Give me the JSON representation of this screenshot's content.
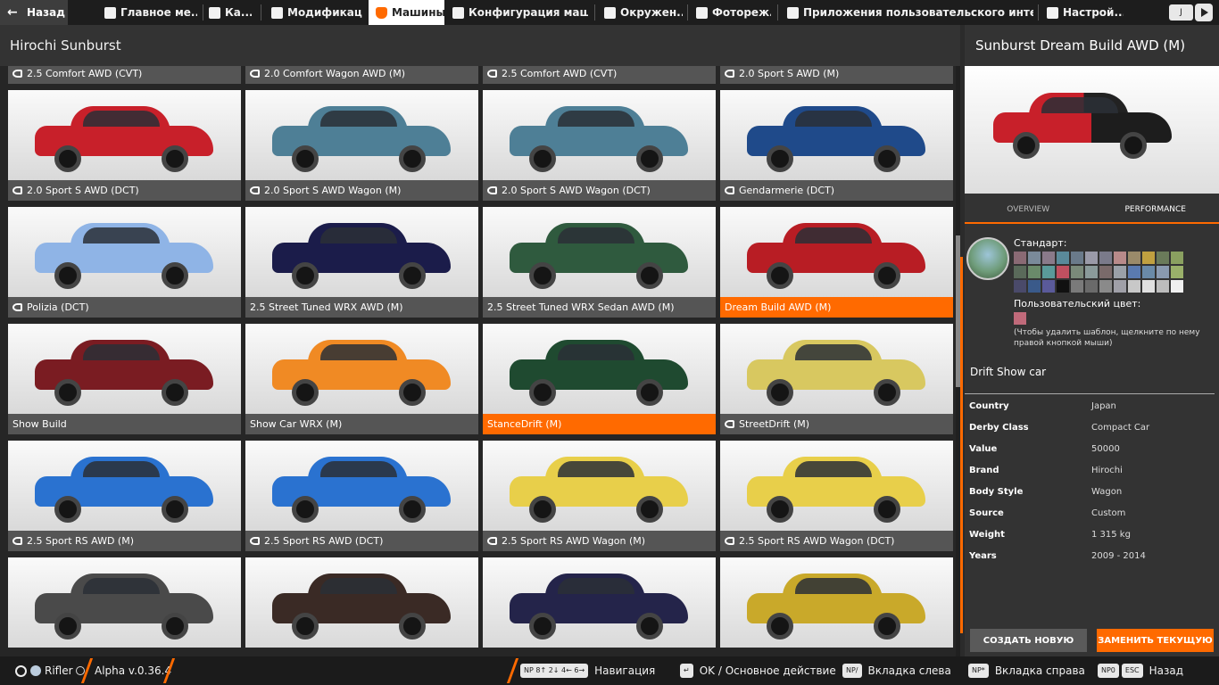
{
  "topbar": {
    "back_label": "Назад",
    "tabs": [
      {
        "label": "Главное ме...",
        "icon": "grid-icon"
      },
      {
        "label": "Ка...",
        "icon": "map-icon"
      },
      {
        "label": "Модификац...",
        "icon": "puzzle-icon"
      },
      {
        "label": "Машины",
        "icon": "car-icon",
        "active": true
      },
      {
        "label": "Конфигурация маши...",
        "icon": "engine-icon"
      },
      {
        "label": "Окружен...",
        "icon": "weather-icon"
      },
      {
        "label": "Фотореж...",
        "icon": "camera-icon"
      },
      {
        "label": "Приложения пользовательского интерфе...",
        "icon": "apps-icon"
      },
      {
        "label": "Настрой...",
        "icon": "sliders-icon"
      }
    ],
    "right_key": "J"
  },
  "left": {
    "header_title": "Hirochi Sunburst"
  },
  "tiles": [
    {
      "label": "2.5 Comfort AWD (CVT)",
      "keyed": true,
      "color": "#9a9a9a"
    },
    {
      "label": "2.0 Comfort Wagon AWD (M)",
      "keyed": true,
      "color": "#9a9a9a"
    },
    {
      "label": "2.5 Comfort AWD (CVT)",
      "keyed": true,
      "color": "#9a9a9a"
    },
    {
      "label": "2.0 Sport S AWD (M)",
      "keyed": true,
      "color": "#9a9a9a"
    },
    {
      "label": "2.0 Sport S AWD (DCT)",
      "keyed": true,
      "color": "#c8202a"
    },
    {
      "label": "2.0 Sport S AWD Wagon (M)",
      "keyed": true,
      "color": "#4e7f96"
    },
    {
      "label": "2.0 Sport S AWD Wagon (DCT)",
      "keyed": true,
      "color": "#4e7f96"
    },
    {
      "label": "Gendarmerie (DCT)",
      "keyed": true,
      "color": "#1f4a8a"
    },
    {
      "label": "Polizia (DCT)",
      "keyed": true,
      "color": "#8fb4e6"
    },
    {
      "label": "2.5 Street Tuned WRX AWD (M)",
      "keyed": false,
      "color": "#1b1c4a"
    },
    {
      "label": "2.5 Street Tuned WRX Sedan AWD (M)",
      "keyed": false,
      "color": "#2f5a3e"
    },
    {
      "label": "Dream Build AWD (M)",
      "keyed": false,
      "color": "#b81d24",
      "active": true
    },
    {
      "label": "Show Build",
      "keyed": false,
      "color": "#7a1c22"
    },
    {
      "label": "Show Car WRX (M)",
      "keyed": false,
      "color": "#f08a24"
    },
    {
      "label": "StanceDrift (M)",
      "keyed": false,
      "color": "#1f4a30",
      "active": true
    },
    {
      "label": "StreetDrift (M)",
      "keyed": true,
      "color": "#d8c860"
    },
    {
      "label": "2.5 Sport RS AWD (M)",
      "keyed": true,
      "color": "#2a72d0"
    },
    {
      "label": "2.5 Sport RS AWD (DCT)",
      "keyed": true,
      "color": "#2a72d0"
    },
    {
      "label": "2.5 Sport RS AWD Wagon (M)",
      "keyed": true,
      "color": "#e8cf4a"
    },
    {
      "label": "2.5 Sport RS AWD Wagon (DCT)",
      "keyed": true,
      "color": "#e8cf4a"
    },
    {
      "label": "",
      "keyed": false,
      "color": "#4a4a4a"
    },
    {
      "label": "",
      "keyed": false,
      "color": "#3a2a25"
    },
    {
      "label": "",
      "keyed": false,
      "color": "#24244a"
    },
    {
      "label": "",
      "keyed": false,
      "color": "#c9a92a"
    }
  ],
  "detail": {
    "title": "Sunburst Dream Build AWD (M)",
    "tab_overview": "OVERVIEW",
    "tab_performance": "PERFORMANCE",
    "standard_label": "Стандарт:",
    "custom_label": "Пользовательский цвет:",
    "hint": "(Чтобы удалить шаблон, щелкните по нему правой кнопкой мыши)",
    "description": "Drift Show car",
    "swatches": [
      "#8a6a74",
      "#7a8a9a",
      "#8a7a8a",
      "#5a8a9a",
      "#6a7a8a",
      "#9a9aa8",
      "#7a7a8a",
      "#b88a8a",
      "#9a8a6a",
      "#c0a040",
      "#6a7a5a",
      "#8aa060",
      "#5a6a5a",
      "#6a8a6a",
      "#5a9a9a",
      "#c05060",
      "#7a8a7a",
      "#8a9a9a",
      "#7a6a6a",
      "#9aa0a8",
      "#5a7ab0",
      "#6a8aa8",
      "#8a9ab0",
      "#9ab06a",
      "#4a4a6a",
      "#3a5a8a",
      "#5a5a9a",
      "#111111",
      "#7a7a7a",
      "#6a6a6a",
      "#8a8a8a",
      "#a0a0a8",
      "#c8c8c8",
      "#e0e0e0",
      "#bcbcbc",
      "#f0f0f0"
    ],
    "info": [
      {
        "key": "Country",
        "value": "Japan"
      },
      {
        "key": "Derby Class",
        "value": "Compact Car"
      },
      {
        "key": "Value",
        "value": "50000"
      },
      {
        "key": "Brand",
        "value": "Hirochi"
      },
      {
        "key": "Body Style",
        "value": "Wagon"
      },
      {
        "key": "Source",
        "value": "Custom"
      },
      {
        "key": "Weight",
        "value": "1 315 kg"
      },
      {
        "key": "Years",
        "value": "2009 - 2014"
      }
    ],
    "btn_new": "СОЗДАТЬ НОВУЮ",
    "btn_replace": "ЗАМЕНИТЬ ТЕКУЩУЮ"
  },
  "bottombar": {
    "user": "Rifler",
    "version": "Alpha v.0.36.4",
    "nav_keys": "NP 8↑ 2↓ 4← 6→",
    "nav_label": "Навигация",
    "ok_key": "↵",
    "ok_label": "OK / Основное действие",
    "left_key": "NP/",
    "left_label": "Вкладка слева",
    "right_key": "NP*",
    "right_label": "Вкладка справа",
    "back_key1": "NP0",
    "back_key2": "ESC",
    "back_label": "Назад"
  }
}
